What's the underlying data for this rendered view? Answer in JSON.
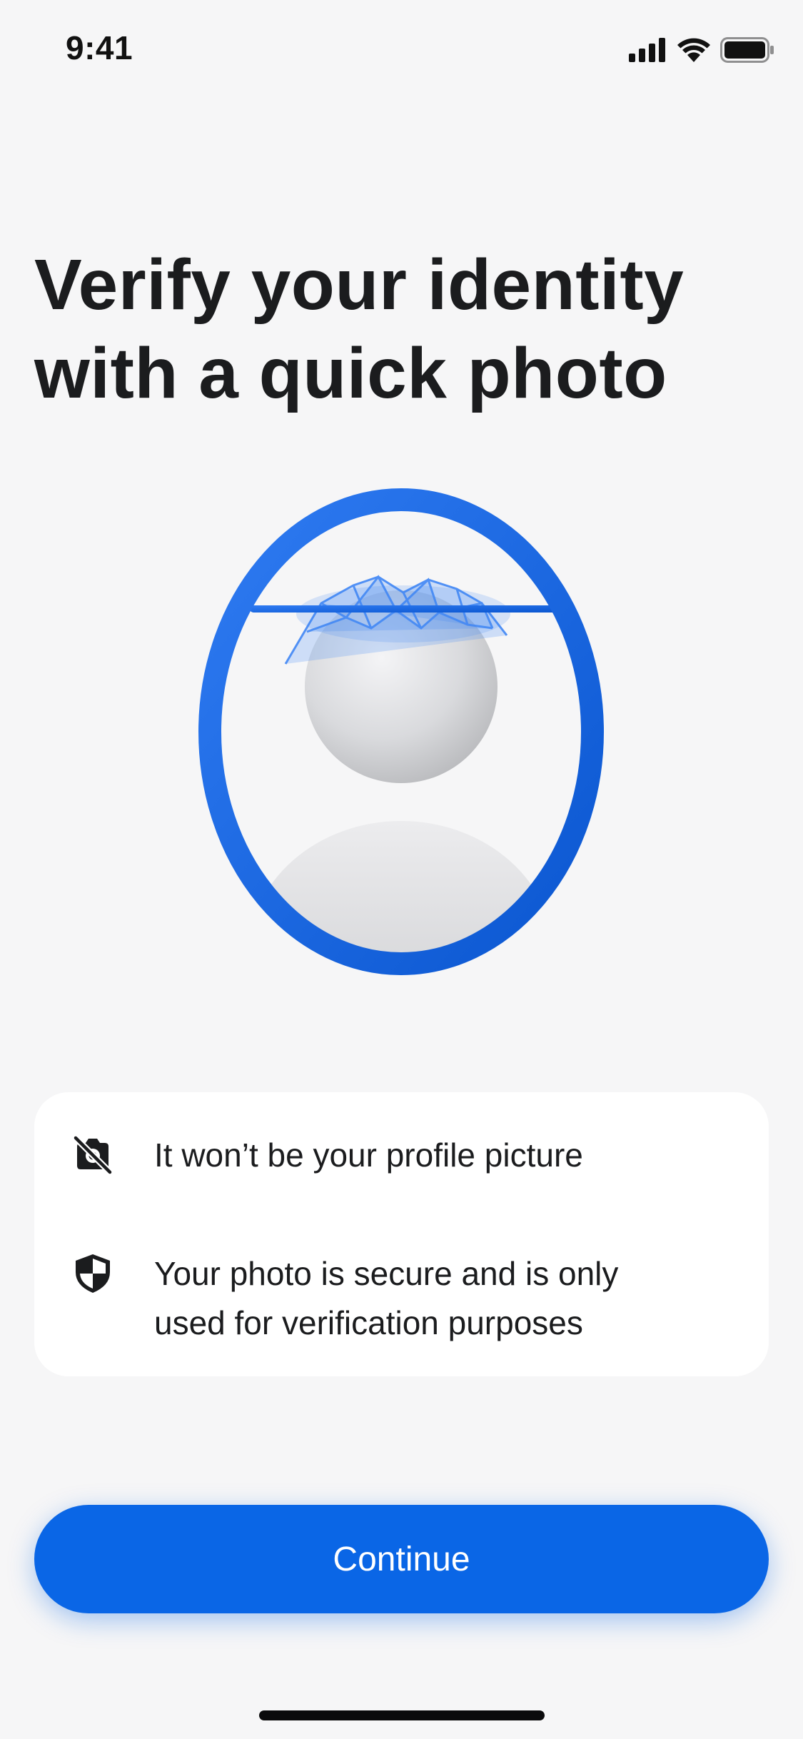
{
  "status_bar": {
    "time": "9:41",
    "icons": [
      "cellular-signal-icon",
      "wifi-icon",
      "battery-icon"
    ]
  },
  "header": {
    "title": "Verify your identity with a quick photo"
  },
  "illustration": {
    "icon": "face-scan-illustration"
  },
  "info_card": {
    "items": [
      {
        "icon": "camera-off-icon",
        "text": "It won’t be your profile picture"
      },
      {
        "icon": "shield-icon",
        "text": "Your photo is secure and is only used for verification purposes"
      }
    ]
  },
  "actions": {
    "continue_label": "Continue"
  },
  "colors": {
    "accent": "#0a66e6",
    "background": "#f6f6f7",
    "card": "#ffffff",
    "text": "#1b1c1e"
  }
}
